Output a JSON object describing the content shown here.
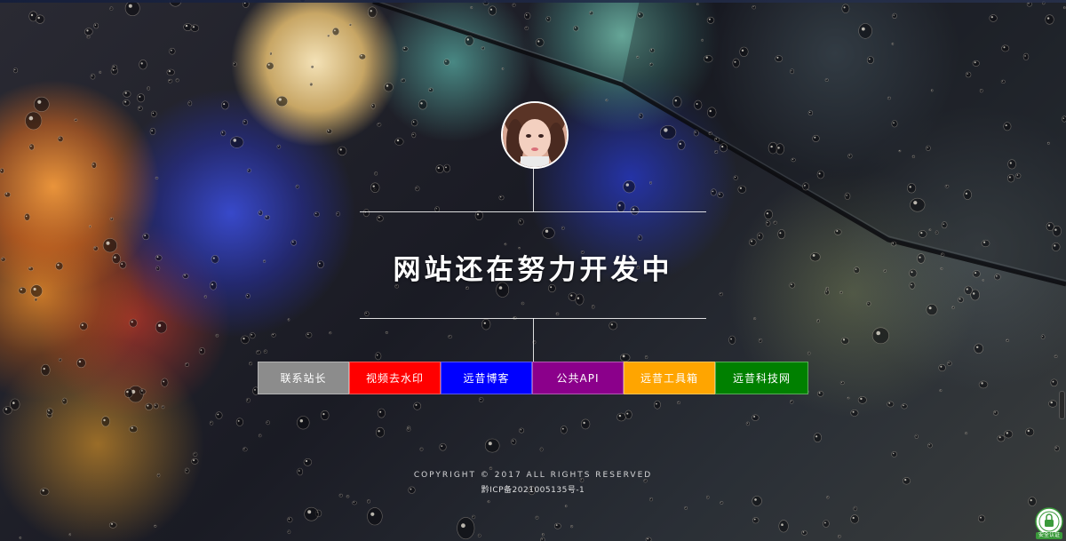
{
  "page": {
    "title": "网站还在努力开发中"
  },
  "nav": {
    "items": [
      {
        "label": "联系站长",
        "color": "#8c8c8c"
      },
      {
        "label": "视频去水印",
        "color": "#ff0000"
      },
      {
        "label": "远昔博客",
        "color": "#0000ff"
      },
      {
        "label": "公共API",
        "color": "#8b008b"
      },
      {
        "label": "远昔工具箱",
        "color": "#ffa500"
      },
      {
        "label": "远昔科技网",
        "color": "#008000"
      }
    ]
  },
  "footer": {
    "copyright": "COPYRIGHT © 2017 ALL RIGHTS RESERVED",
    "icp": "黔ICP备2021005135号-1"
  },
  "icons": {
    "avatar": "avatar-photo",
    "badge": "security-badge-icon"
  },
  "badge": {
    "label": "安全认证"
  }
}
